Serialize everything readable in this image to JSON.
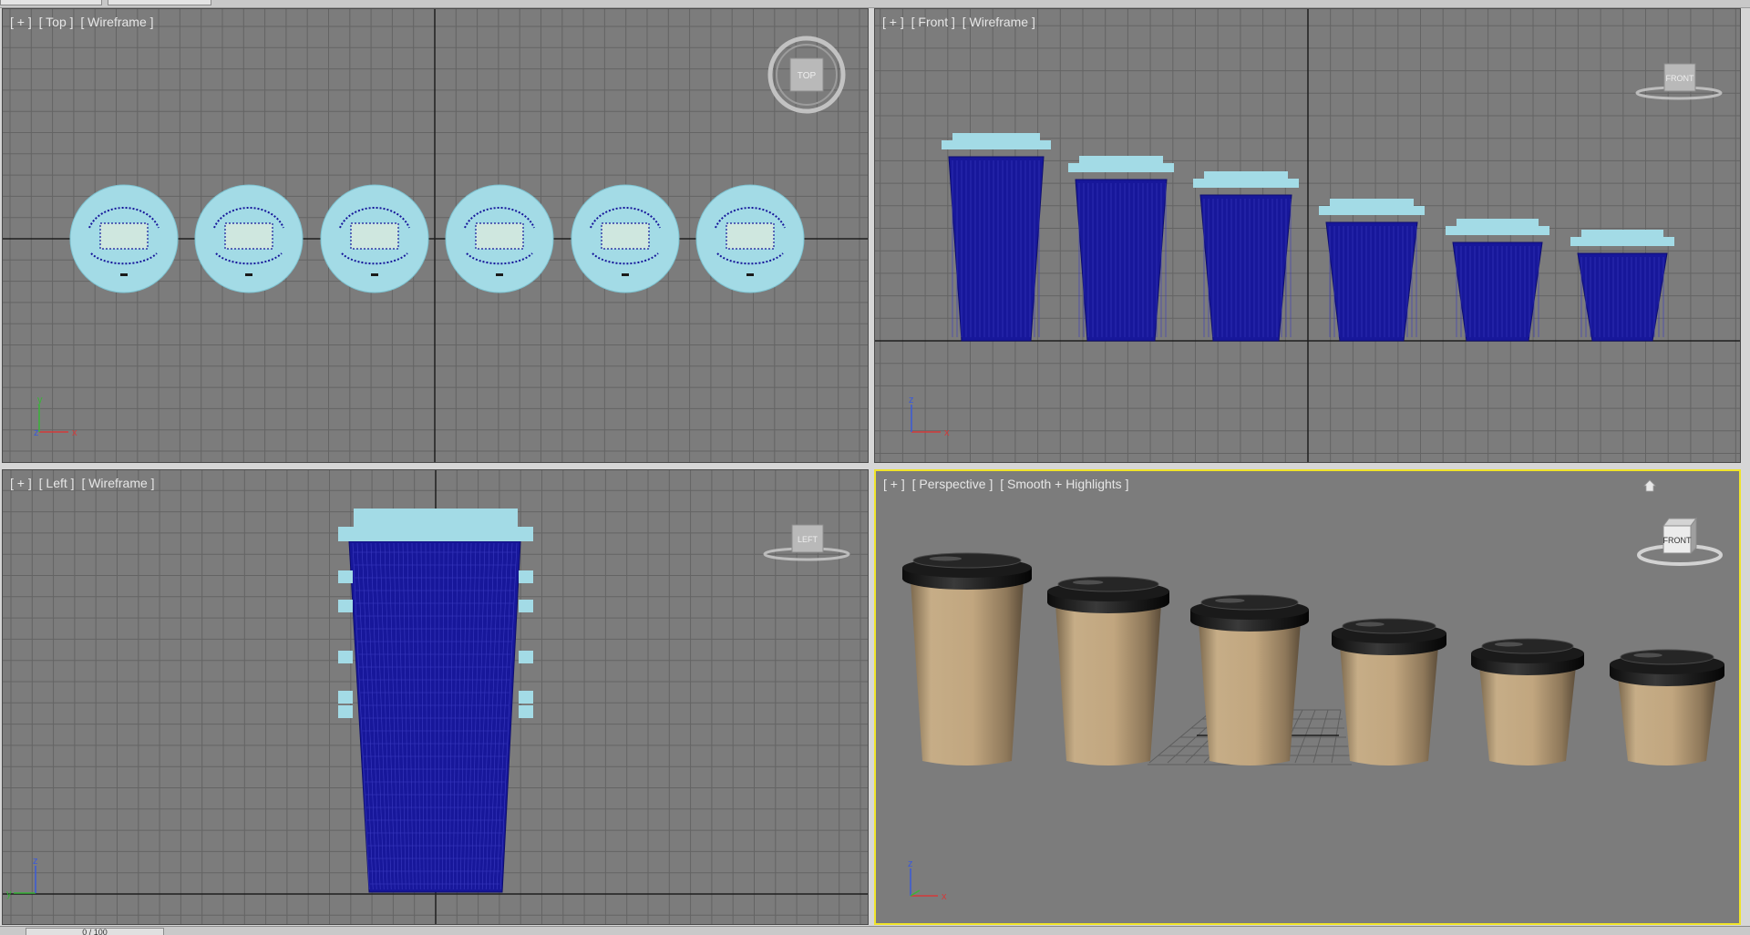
{
  "viewports": {
    "top": {
      "plus": "[ + ]",
      "view": "[ Top ]",
      "mode": "[ Wireframe ]",
      "cube": "TOP"
    },
    "front": {
      "plus": "[ + ]",
      "view": "[ Front ]",
      "mode": "[ Wireframe ]",
      "cube": "FRONT"
    },
    "left": {
      "plus": "[ + ]",
      "view": "[ Left ]",
      "mode": "[ Wireframe ]",
      "cube": "LEFT"
    },
    "persp": {
      "plus": "[ + ]",
      "view": "[ Perspective ]",
      "mode": "[ Smooth + Highlights ]",
      "cube": "FRONT"
    }
  },
  "axes": {
    "x": "x",
    "y": "y",
    "z": "z"
  },
  "timeline": {
    "frame": "0 / 100"
  },
  "colors": {
    "viewport_bg": "#7c7c7c",
    "grid": "#646464",
    "world_axis": "#1e1e1e",
    "lid_wire": "#a3dbe6",
    "cup_wire": "#17179a",
    "active_border": "#f0e42a",
    "cup_paper": "#bba17c",
    "lid_black": "#111111"
  }
}
